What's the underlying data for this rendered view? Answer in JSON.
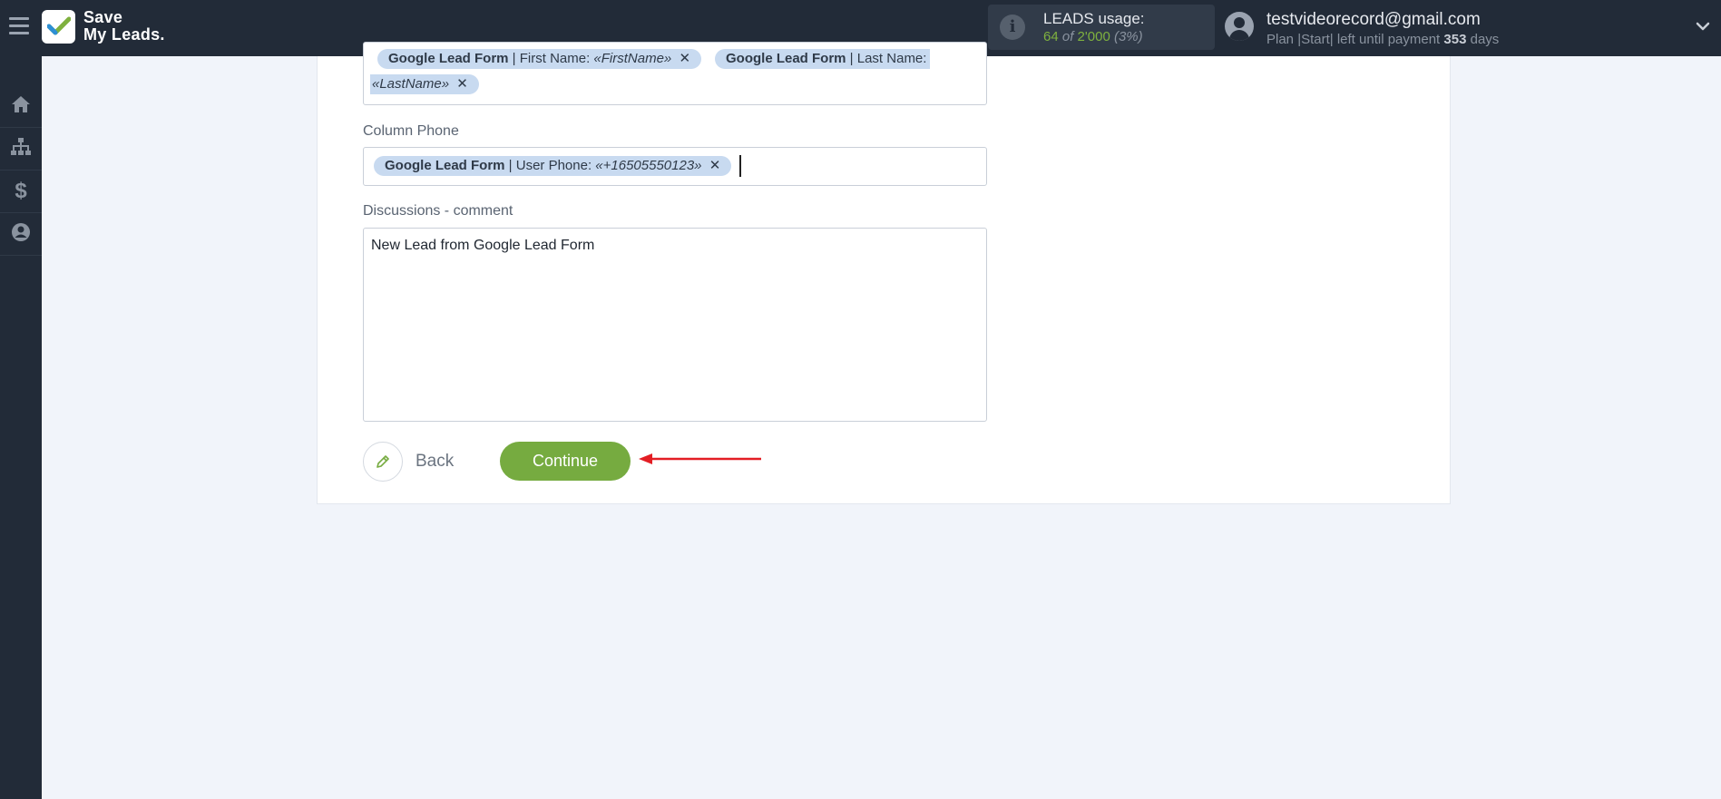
{
  "app": {
    "logo_line1": "Save",
    "logo_line2": "My Leads."
  },
  "usage": {
    "title": "LEADS usage:",
    "used": "64",
    "of_word": "of",
    "limit": "2'000",
    "percent": "(3%)"
  },
  "account": {
    "email": "testvideorecord@gmail.com",
    "plan_prefix": "Plan |Start| left until payment",
    "days_left": "353",
    "days_word": "days"
  },
  "nav": {
    "items": [
      "home-icon",
      "sitemap-icon",
      "dollar-icon",
      "user-icon"
    ]
  },
  "form": {
    "name_field": {
      "tag1_source": "Google Lead Form",
      "tag1_rest": " | First Name: ",
      "tag1_value": "«FirstName»",
      "tag2_source": "Google Lead Form",
      "tag2_rest": " | Last Name:",
      "tag2_value": "«LastName»",
      "remove_symbol": "✕"
    },
    "phone_field": {
      "label": "Column Phone",
      "tag_source": "Google Lead Form",
      "tag_rest": " | User Phone: ",
      "tag_value": "«+16505550123»",
      "remove_symbol": "✕"
    },
    "comment_field": {
      "label": "Discussions - comment",
      "value": "New Lead from Google Lead Form"
    }
  },
  "actions": {
    "back_label": "Back",
    "continue_label": "Continue"
  },
  "colors": {
    "topbar": "#222b38",
    "accent_green": "#76ab40",
    "tag_bg": "#c8daf0",
    "arrow_red": "#e31e24"
  }
}
